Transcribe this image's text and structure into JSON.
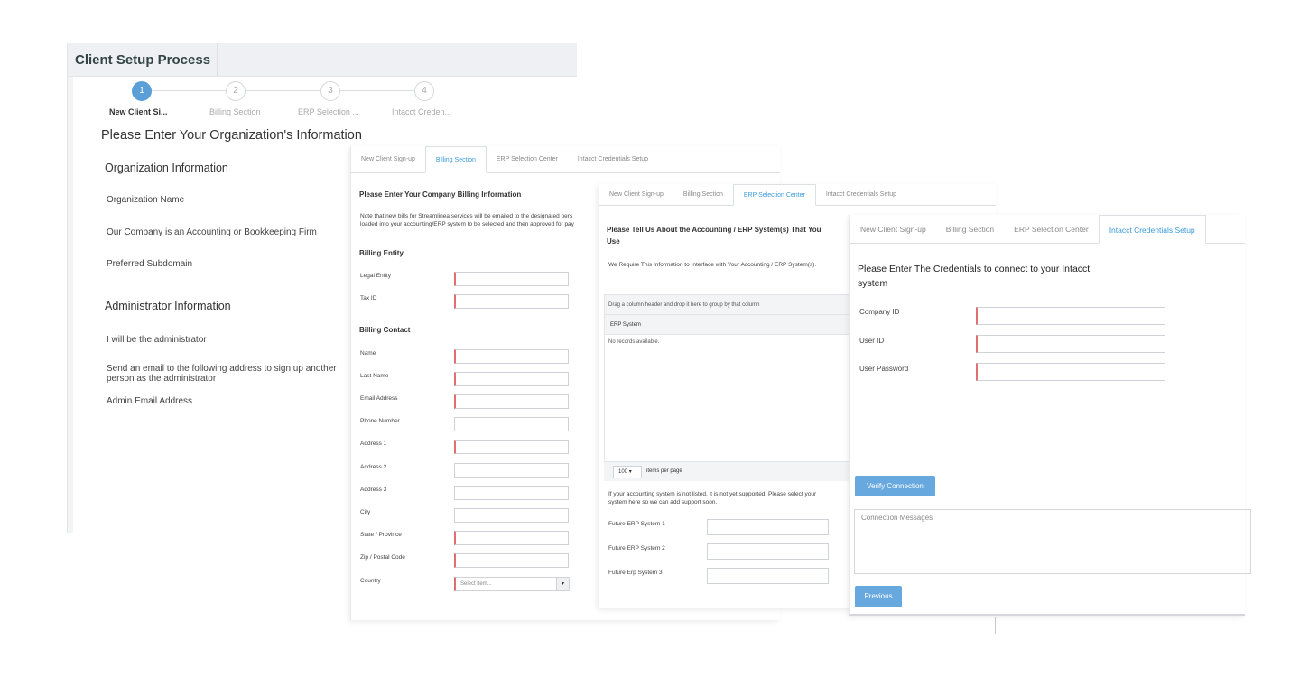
{
  "wizard": {
    "title": "Client Setup Process",
    "steps": [
      {
        "num": "1",
        "label": "New Client Si..."
      },
      {
        "num": "2",
        "label": "Billing Section"
      },
      {
        "num": "3",
        "label": "ERP Selection ..."
      },
      {
        "num": "4",
        "label": "Intacct Creden..."
      }
    ],
    "page_title": "Please Enter Your Organization's Information",
    "org_section": "Organization Information",
    "org_fields": [
      "Organization Name",
      "Our Company is an Accounting or Bookkeeping Firm",
      "Preferred Subdomain"
    ],
    "admin_section": "Administrator Information",
    "admin_fields": [
      "I will be the administrator",
      "Send an email to the following address to sign up another person as the administrator",
      "Admin Email Address"
    ]
  },
  "billing": {
    "tabs": [
      "New Client Sign-up",
      "Billing Section",
      "ERP Selection Center",
      "Intacct Credentials Setup"
    ],
    "heading": "Please Enter Your Company Billing Information",
    "note": "Note that new bills for Streamlinea services will be emailed to the designated pers loaded into your accounting/ERP system to be selected and then approved for pay",
    "entity_heading": "Billing Entity",
    "entity_fields": [
      "Legal Entity",
      "Tax ID"
    ],
    "contact_heading": "Billing Contact",
    "contact_fields": [
      "Name",
      "Last Name",
      "Email Address",
      "Phone Number",
      "Address 1",
      "Address 2",
      "Address 3",
      "City",
      "State / Province",
      "Zip / Postal Code",
      "Country"
    ],
    "country_placeholder": "Select item...",
    "dropdown_arrow": "▾"
  },
  "erp": {
    "tabs": [
      "New Client Sign-up",
      "Billing Section",
      "ERP Selection Center",
      "Intacct Credentials Setup"
    ],
    "heading": "Please Tell Us About the Accounting / ERP System(s) That You Use",
    "note": "We Require This Information to Interface with Your Accounting / ERP System(s).",
    "group_hint": "Drag a column header and drop it here to group by that column",
    "column": "ERP System",
    "empty": "No records available.",
    "page_size": "100",
    "per_page": "items per page",
    "dropdown_arrow": "▾",
    "unsupported_note": "If your accounting system is not listed, it is not yet supported. Please select your system here so we can add support soon.",
    "future_fields": [
      "Future ERP System 1",
      "Future ERP System 2",
      "Future Erp System 3"
    ]
  },
  "intacct": {
    "tabs": [
      "New Client Sign-up",
      "Billing Section",
      "ERP Selection Center",
      "Intacct Credentials Setup"
    ],
    "heading": "Please Enter The Credentials to connect to your Intacct system",
    "fields": [
      "Company ID",
      "User ID",
      "User Password"
    ],
    "verify_button": "Verify Connection",
    "messages_placeholder": "Connection Messages",
    "previous_button": "Previous"
  },
  "colors": {
    "accent": "#5b9fd8",
    "tab_active": "#3a9ad9",
    "required": "#e07070",
    "button": "#67a9de"
  }
}
